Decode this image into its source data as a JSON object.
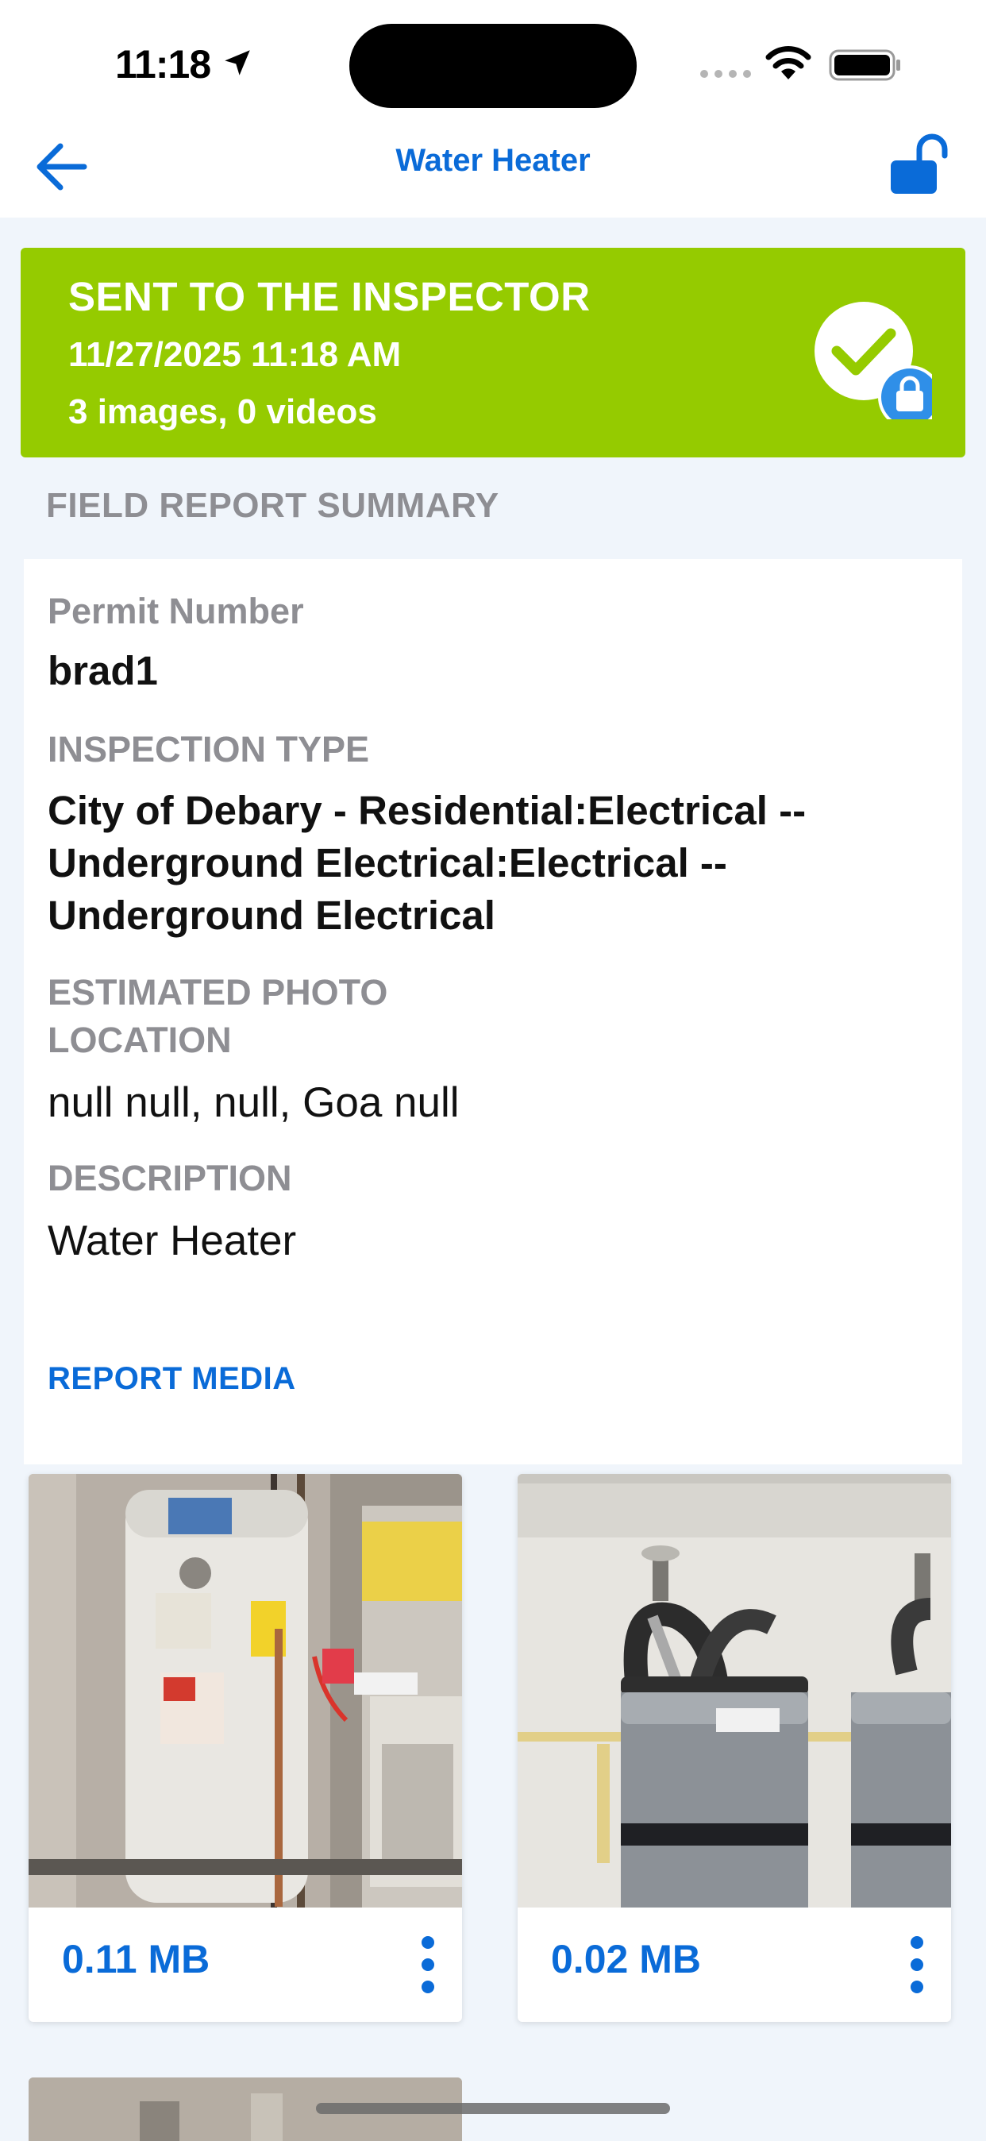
{
  "status_bar": {
    "time": "11:18"
  },
  "nav": {
    "title": "Water Heater"
  },
  "banner": {
    "title": "SENT TO THE INSPECTOR",
    "date": "11/27/2025 11:18 AM",
    "counts": "3 images, 0 videos",
    "color": "#95cb00"
  },
  "summary": {
    "section_header": "FIELD REPORT SUMMARY",
    "permit_label": "Permit Number",
    "permit_value": "brad1",
    "inspection_label": "INSPECTION TYPE",
    "inspection_value_lines": [
      "City of Debary - Residential:Electrical --",
      "Underground Electrical:Electrical --",
      "Underground Electrical"
    ],
    "location_label_lines": [
      "ESTIMATED PHOTO",
      "LOCATION"
    ],
    "location_value": "null null, null, Goa null",
    "description_label": "DESCRIPTION",
    "description_value": "Water Heater",
    "report_media_link": "REPORT MEDIA"
  },
  "media": [
    {
      "size": "0.11 MB",
      "thumb": "water-heater-photo-1"
    },
    {
      "size": "0.02 MB",
      "thumb": "water-heater-photo-2"
    }
  ],
  "colors": {
    "accent": "#0a6bd8",
    "label_gray": "#8e8e93",
    "background": "#f0f5fb"
  }
}
